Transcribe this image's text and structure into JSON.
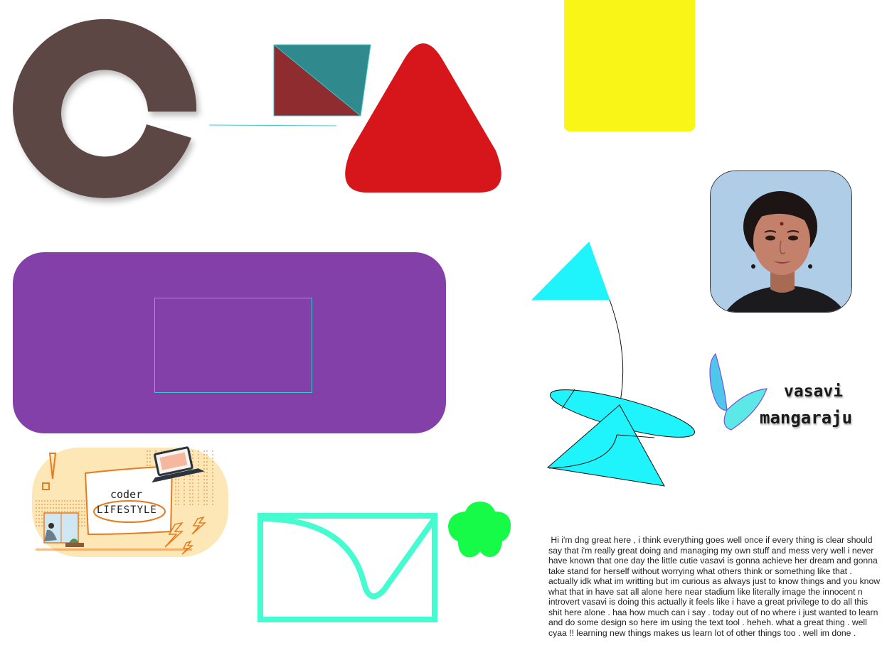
{
  "canvas": {
    "background": "#ffffff"
  },
  "colors": {
    "ring": "#5c4644",
    "teal": "#30898c",
    "maroon": "#8e2c2f",
    "red_triangle": "#d7161c",
    "yellow": "#f8f517",
    "purple": "#8440a9",
    "cyan_shape": "#1ff3fb",
    "mint": "#45fbd0",
    "green_star": "#16fb48",
    "sticker_bg": "#fde7b6",
    "sticker_accent": "#e77b1d"
  },
  "sticker": {
    "line1": "coder",
    "line2": "LIFESTYLE"
  },
  "signature": {
    "first_name": "vasavi",
    "last_name": "mangaraju"
  },
  "note": {
    "text": " Hi i'm dng great here , i think everything goes well once if every thing is clear should say that i'm really great doing and managing my own stuff and mess very well i never have known that one day the little cutie vasavi is gonna achieve her dream and gonna take stand for herself without worrying what others think or something like that . actually idk what im writting but im curious as always just to know things and you know what that in have sat all alone here near stadium like literally image the innocent n introvert vasavi is doing this actually it feels like i have a great privilege to do all this shit here alone . haa how much can i say . today out of no where i just wanted to learn and do some design so here im using the text tool . heheh. what a great thing . well cyaa !! learning new things makes us learn lot of other things too . well im done ."
  }
}
